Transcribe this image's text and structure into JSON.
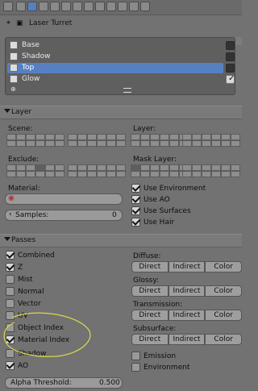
{
  "title": "Laser Turret",
  "render_layers": [
    {
      "label": "Base",
      "enabled": false,
      "selected": false
    },
    {
      "label": "Shadow",
      "enabled": false,
      "selected": false
    },
    {
      "label": "Top",
      "enabled": false,
      "selected": true
    },
    {
      "label": "Glow",
      "enabled": true,
      "selected": false
    }
  ],
  "panels": {
    "layer": {
      "title": "Layer",
      "scene_label": "Scene:",
      "layer_label": "Layer:",
      "exclude_label": "Exclude:",
      "mask_layer_label": "Mask Layer:",
      "material_label": "Material:",
      "use_environment": "Use Environment",
      "use_ao": "Use AO",
      "use_surfaces": "Use Surfaces",
      "use_hair": "Use Hair",
      "samples_label": "Samples:",
      "samples_value": "0"
    },
    "passes": {
      "title": "Passes",
      "left_items": [
        {
          "label": "Combined",
          "checked": true
        },
        {
          "label": "Z",
          "checked": true
        },
        {
          "label": "Mist",
          "checked": false
        },
        {
          "label": "Normal",
          "checked": false
        },
        {
          "label": "Vector",
          "checked": false
        },
        {
          "label": "UV",
          "checked": false
        },
        {
          "label": "Object Index",
          "checked": false
        },
        {
          "label": "Material Index",
          "checked": true
        },
        {
          "label": "Shadow",
          "checked": false
        },
        {
          "label": "AO",
          "checked": true
        }
      ],
      "groups": [
        {
          "label": "Diffuse:",
          "buttons": [
            "Direct",
            "Indirect",
            "Color"
          ]
        },
        {
          "label": "Glossy:",
          "buttons": [
            "Direct",
            "Indirect",
            "Color"
          ]
        },
        {
          "label": "Transmission:",
          "buttons": [
            "Direct",
            "Indirect",
            "Color"
          ]
        },
        {
          "label": "Subsurface:",
          "buttons": [
            "Direct",
            "Indirect",
            "Color"
          ]
        }
      ],
      "emission": "Emission",
      "environment": "Environment",
      "alpha_label": "Alpha Threshold:",
      "alpha_value": "0.500"
    }
  },
  "colors": {
    "accent": "#5680c2",
    "annotation": "#dcd84a"
  }
}
